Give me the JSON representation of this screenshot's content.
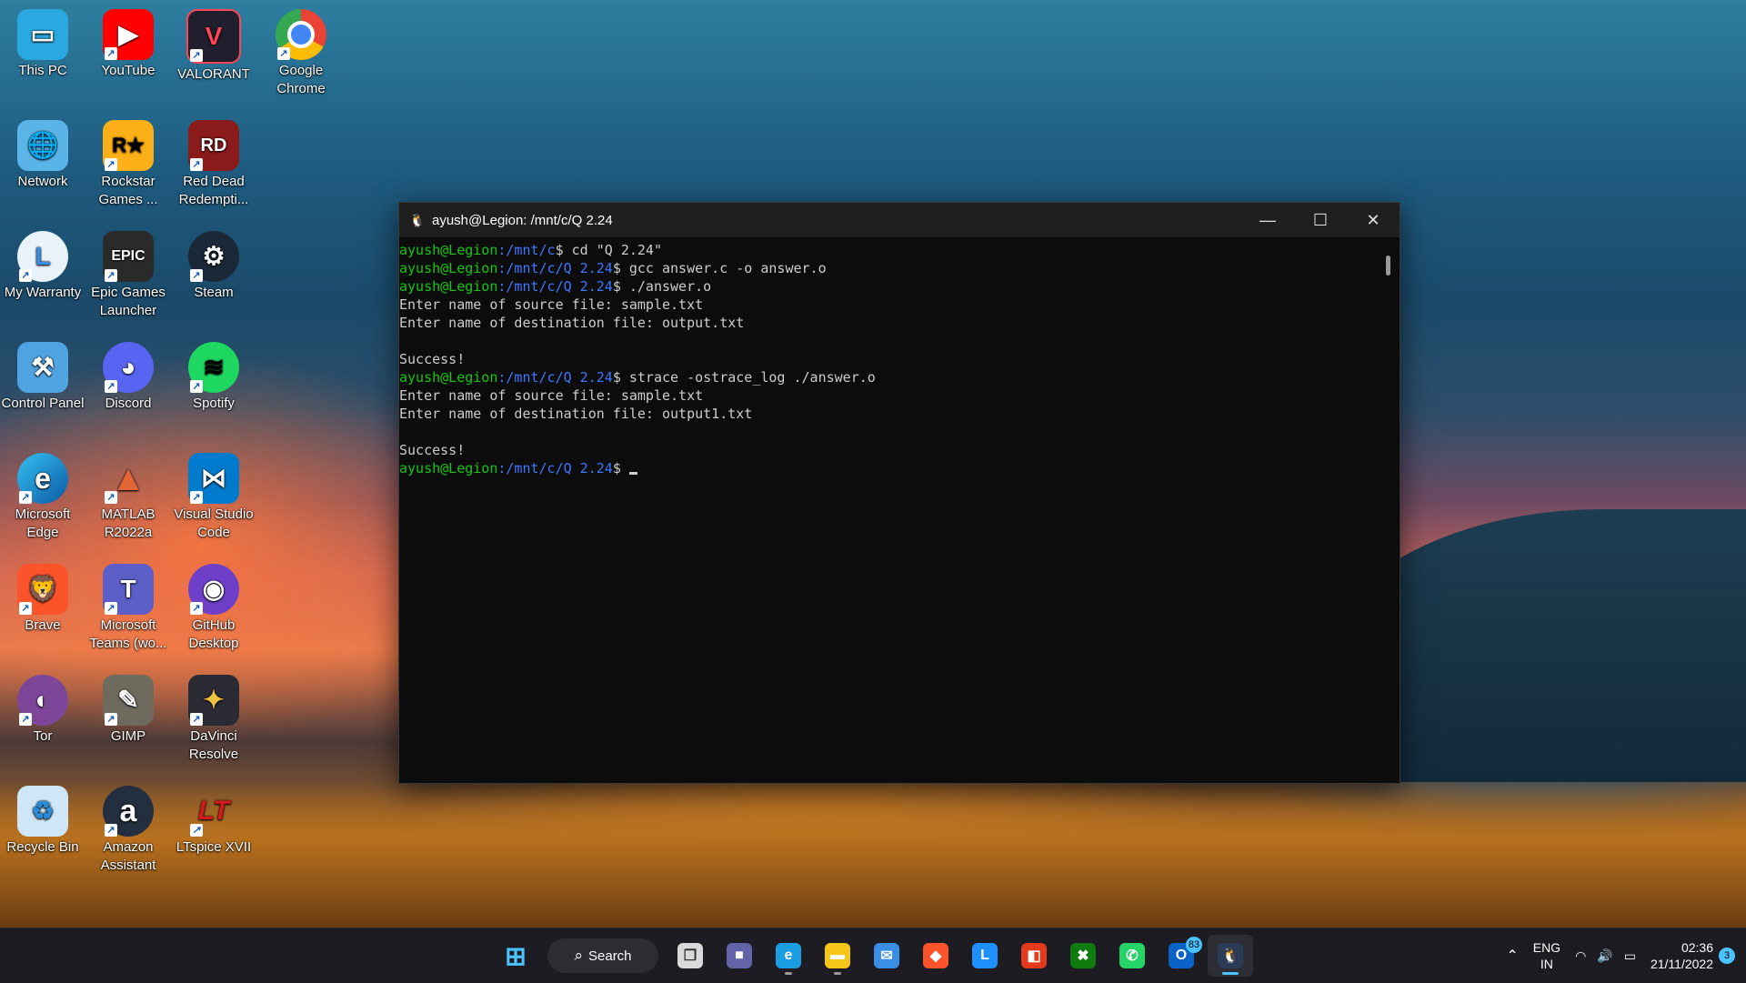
{
  "colors": {
    "prompt_user": "#16c60c",
    "prompt_path": "#3b78ff",
    "terminal_bg": "#0c0c0c",
    "taskbar_bg": "#1c1c22",
    "accent": "#4cc2ff"
  },
  "desktop": {
    "icons": [
      {
        "label": "This PC",
        "icon": "this-pc-icon"
      },
      {
        "label": "YouTube",
        "icon": "youtube-icon"
      },
      {
        "label": "VALORANT",
        "icon": "valorant-icon"
      },
      {
        "label": "Google Chrome",
        "icon": "chrome-icon"
      },
      {
        "label": "Network",
        "icon": "network-icon"
      },
      {
        "label": "Rockstar Games ...",
        "icon": "rockstar-icon"
      },
      {
        "label": "Red Dead Redempti...",
        "icon": "red-dead-icon"
      },
      {
        "label": "My Warranty",
        "icon": "warranty-icon"
      },
      {
        "label": "Epic Games Launcher",
        "icon": "epic-games-icon"
      },
      {
        "label": "Steam",
        "icon": "steam-icon"
      },
      {
        "label": "Control Panel",
        "icon": "control-panel-icon"
      },
      {
        "label": "Discord",
        "icon": "discord-icon"
      },
      {
        "label": "Spotify",
        "icon": "spotify-icon"
      },
      {
        "label": "Microsoft Edge",
        "icon": "edge-icon"
      },
      {
        "label": "MATLAB R2022a",
        "icon": "matlab-icon"
      },
      {
        "label": "Visual Studio Code",
        "icon": "vscode-icon"
      },
      {
        "label": "Brave",
        "icon": "brave-icon"
      },
      {
        "label": "Microsoft Teams (wo...",
        "icon": "teams-icon"
      },
      {
        "label": "GitHub Desktop",
        "icon": "github-icon"
      },
      {
        "label": "Tor",
        "icon": "tor-icon"
      },
      {
        "label": "GIMP",
        "icon": "gimp-icon"
      },
      {
        "label": "DaVinci Resolve",
        "icon": "davinci-icon"
      },
      {
        "label": "Recycle Bin",
        "icon": "recycle-bin-icon"
      },
      {
        "label": "Amazon Assistant",
        "icon": "amazon-icon"
      },
      {
        "label": "LTspice XVII",
        "icon": "ltspice-icon"
      }
    ],
    "glyphs": {
      "youtube": "▶",
      "valorant": "V",
      "rockstar": "R★",
      "red_dead": "RD",
      "warranty": "L",
      "epic": "EPIC",
      "steam": "⚙",
      "discord": "◕",
      "spotify": "≋",
      "edge": "e",
      "matlab": "▲",
      "vscode": "⋈",
      "brave": "🦁",
      "teams": "T",
      "github": "◉",
      "tor": "◐",
      "gimp": "✎",
      "davinci": "✦",
      "recycle": "♻",
      "amazon": "a",
      "ltspice": "LT",
      "this_pc": "▭",
      "network": "🌐",
      "control_panel": "⚒",
      "chrome": "◎"
    },
    "shortcut_arrow": "↗"
  },
  "terminal": {
    "title": "ayush@Legion: /mnt/c/Q 2.24",
    "minimize_glyph": "—",
    "maximize_glyph": "☐",
    "close_glyph": "✕",
    "tux_glyph": "🐧",
    "lines": [
      {
        "user": "ayush@Legion",
        "path": ":/mnt/c",
        "cmd": "$ cd \"Q 2.24\""
      },
      {
        "user": "ayush@Legion",
        "path": ":/mnt/c/Q 2.24",
        "cmd": "$ gcc answer.c -o answer.o"
      },
      {
        "user": "ayush@Legion",
        "path": ":/mnt/c/Q 2.24",
        "cmd": "$ ./answer.o"
      },
      {
        "text": "Enter name of source file: sample.txt"
      },
      {
        "text": "Enter name of destination file: output.txt"
      },
      {
        "text": ""
      },
      {
        "text": "Success!"
      },
      {
        "user": "ayush@Legion",
        "path": ":/mnt/c/Q 2.24",
        "cmd": "$ strace -ostrace_log ./answer.o"
      },
      {
        "text": "Enter name of source file: sample.txt"
      },
      {
        "text": "Enter name of destination file: output1.txt"
      },
      {
        "text": ""
      },
      {
        "text": "Success!"
      },
      {
        "user": "ayush@Legion",
        "path": ":/mnt/c/Q 2.24",
        "cmd": "$ ",
        "cursor": true
      }
    ]
  },
  "taskbar": {
    "search_label": "Search",
    "search_glyph": "⌕",
    "start_glyph": "⊞",
    "apps": [
      {
        "name": "task-view",
        "glyph": "❐",
        "color": "#d9d9d9"
      },
      {
        "name": "teams-chat",
        "glyph": "■",
        "color": "#6264a7"
      },
      {
        "name": "edge",
        "glyph": "e",
        "color": "#1b9de2",
        "running": true
      },
      {
        "name": "file-explorer",
        "glyph": "▬",
        "color": "#f5c518",
        "running": true
      },
      {
        "name": "mail",
        "glyph": "✉",
        "color": "#3a8ee6"
      },
      {
        "name": "brave",
        "glyph": "◆",
        "color": "#fb542b"
      },
      {
        "name": "lenovo-vantage",
        "glyph": "L",
        "color": "#1e90ff"
      },
      {
        "name": "office",
        "glyph": "◧",
        "color": "#e33a1d"
      },
      {
        "name": "xbox",
        "glyph": "✖",
        "color": "#107c10"
      },
      {
        "name": "whatsapp",
        "glyph": "✆",
        "color": "#25d366"
      },
      {
        "name": "outlook",
        "glyph": "O",
        "color": "#0a64c8",
        "badge": "83"
      },
      {
        "name": "ubuntu-wsl",
        "glyph": "🐧",
        "color": "#2b3a55",
        "active": true
      }
    ],
    "tray": {
      "chevron_glyph": "⌃",
      "lang_top": "ENG",
      "lang_bottom": "IN",
      "wifi_glyph": "◠",
      "volume_glyph": "🔊",
      "battery_glyph": "▭",
      "time": "02:36",
      "date": "21/11/2022",
      "notifications": "3"
    }
  }
}
